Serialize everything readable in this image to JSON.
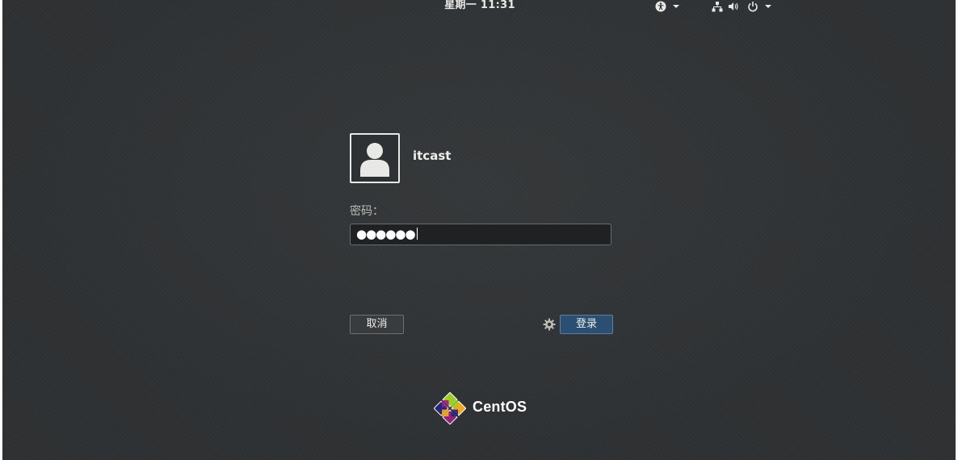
{
  "topbar": {
    "clock": "星期一 11:31",
    "icons": [
      "accessibility-icon",
      "network-icon",
      "volume-icon",
      "power-icon"
    ]
  },
  "login": {
    "username": "itcast",
    "password_label": "密码：",
    "password_mask": "●●●●●●",
    "cancel_label": "取消",
    "login_label": "登录"
  },
  "brand": {
    "name": "CentOS"
  },
  "colors": {
    "background": "#2e3133",
    "login_button": "#2b4f73",
    "text": "#eeeeec"
  }
}
